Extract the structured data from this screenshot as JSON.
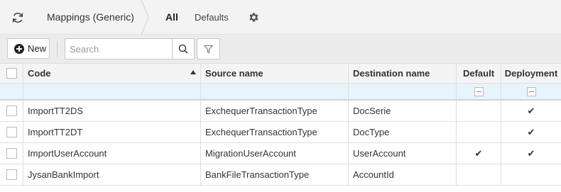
{
  "header": {
    "title": "Mappings (Generic)",
    "tabs": [
      {
        "label": "All",
        "active": true
      },
      {
        "label": "Defaults",
        "active": false
      }
    ],
    "icons": {
      "refresh": "refresh-icon",
      "settings": "gear-icon"
    }
  },
  "toolbar": {
    "new_label": "New",
    "search_placeholder": "Search",
    "search_value": "",
    "icons": {
      "new": "plus-circle-icon",
      "search": "search-icon",
      "filter": "filter-icon"
    }
  },
  "table": {
    "columns": [
      "Code",
      "Source name",
      "Destination name",
      "Default",
      "Deployment"
    ],
    "sort": {
      "column": "Code",
      "direction": "ascending"
    },
    "rows": [
      {
        "code": "ImportTT2DS",
        "source": "ExchequerTransactionType",
        "destination": "DocSerie",
        "default": false,
        "deployment": true
      },
      {
        "code": "ImportTT2DT",
        "source": "ExchequerTransactionType",
        "destination": "DocType",
        "default": false,
        "deployment": true
      },
      {
        "code": "ImportUserAccount",
        "source": "MigrationUserAccount",
        "destination": "UserAccount",
        "default": true,
        "deployment": true
      },
      {
        "code": "JysanBankImport",
        "source": "BankFileTransactionType",
        "destination": "AccountId",
        "default": false,
        "deployment": false
      }
    ]
  },
  "colors": {
    "header_bg": "#f3f3f3",
    "toolbar_bg": "#ececec",
    "filter_row_bg": "#e7f4fb",
    "check": "#333333"
  }
}
